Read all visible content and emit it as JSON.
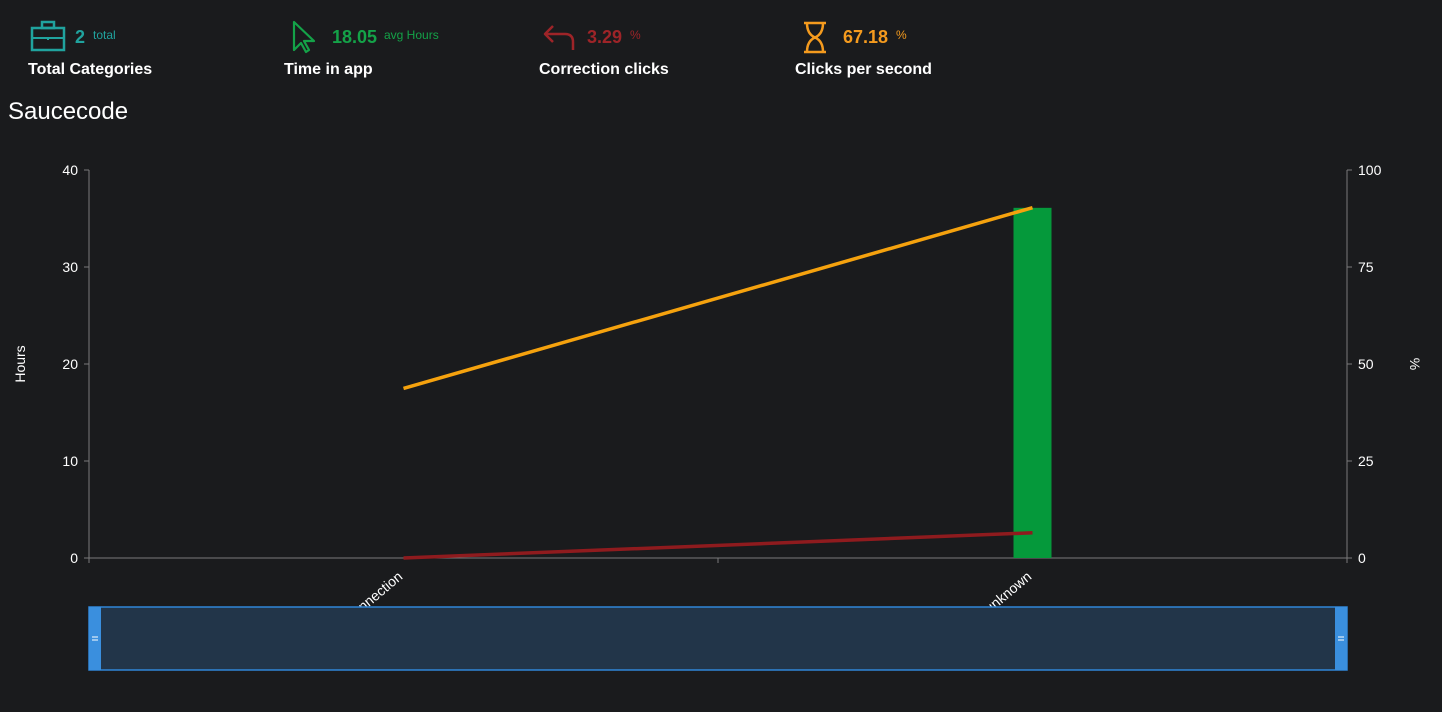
{
  "stats": [
    {
      "value": "2",
      "unit": "total",
      "label": "Total Categories",
      "color": "#20a39e",
      "icon": "briefcase-icon"
    },
    {
      "value": "18.05",
      "unit": "avg Hours",
      "label": "Time in app",
      "color": "#14a248",
      "icon": "cursor-icon"
    },
    {
      "value": "3.29",
      "unit": "%",
      "label": "Correction clicks",
      "color": "#9e2428",
      "icon": "undo-arrow-icon"
    },
    {
      "value": "67.18",
      "unit": "%",
      "label": "Clicks per second",
      "color": "#f59b1e",
      "icon": "hourglass-icon"
    }
  ],
  "page_title": "Saucecode",
  "chart_data": {
    "type": "bar",
    "categories": [
      "Remote Connection",
      "unknown"
    ],
    "series": [
      {
        "type": "bar",
        "axis": "left",
        "color": "#05993b",
        "values": [
          0,
          36.1
        ]
      },
      {
        "type": "line",
        "axis": "right",
        "color": "#f5a20e",
        "values": [
          43.7,
          90.3
        ]
      },
      {
        "type": "line",
        "axis": "right",
        "color": "#8f1b1e",
        "values": [
          0,
          6.5
        ]
      }
    ],
    "ylabel": "Hours",
    "y2label": "%",
    "ylim": [
      0,
      40
    ],
    "y2lim": [
      0,
      100
    ],
    "yticks": [
      "0",
      "10",
      "20",
      "30",
      "40"
    ],
    "y2ticks": [
      "0",
      "25",
      "50",
      "75",
      "100"
    ],
    "grid": false,
    "zoom_slider": true
  }
}
